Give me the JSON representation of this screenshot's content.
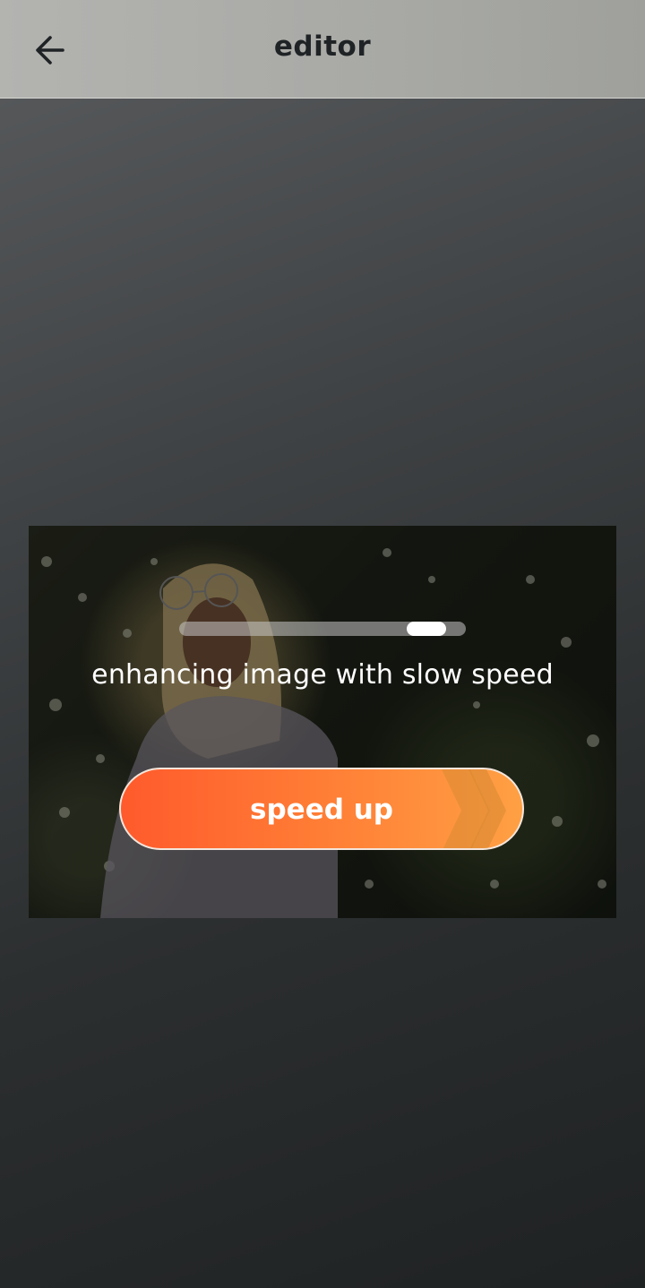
{
  "header": {
    "title": "editor",
    "back_icon": "arrow-left-icon"
  },
  "preview": {
    "status_text": "enhancing image with slow speed",
    "progress_fraction": 0.92,
    "speed_up_label": "speed up",
    "speed_up_icon": "double-chevron-right-icon"
  },
  "colors": {
    "accent_start": "#ff5a2c",
    "accent_end": "#ffa044"
  }
}
